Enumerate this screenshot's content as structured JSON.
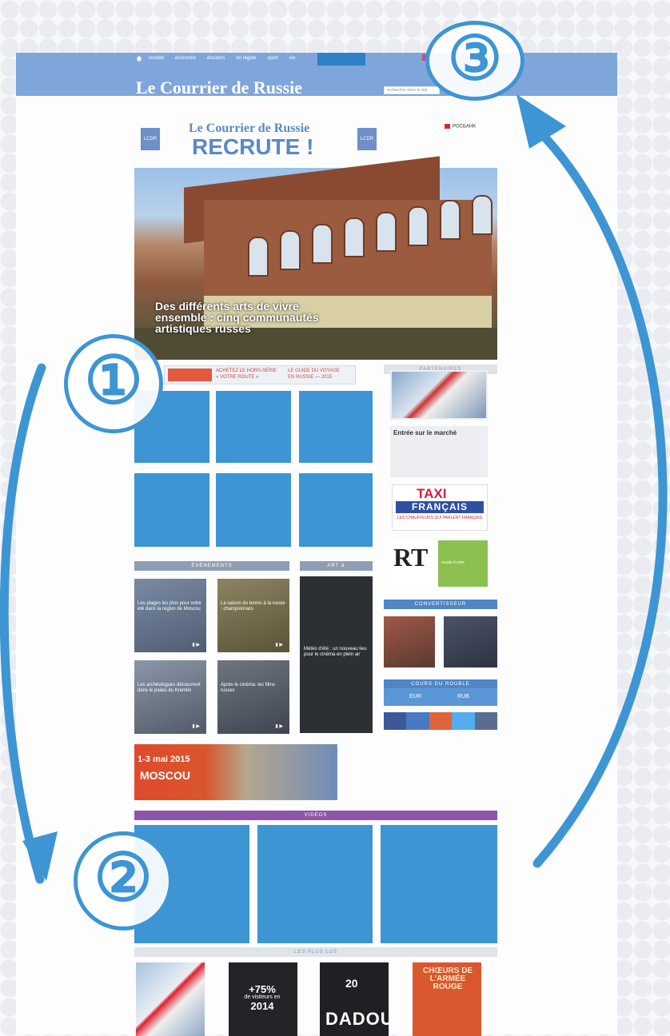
{
  "header": {
    "title": "Le Courrier de Russie",
    "nav": [
      "société",
      "économie",
      "discours",
      "en région",
      "sport",
      "vie"
    ],
    "search_placeholder": "rechercher dans le site"
  },
  "recruit": {
    "kcdr": "LCDR",
    "title_line": "Le Courrier de Russie",
    "title_big": "RECRUTE !",
    "partner": "POCБAHK"
  },
  "hero": {
    "caption": "Des différents arts de vivre ensemble : cinq communautés artistiques russes"
  },
  "adstrip": {
    "line1": "ACHETEZ LE HORS-SÉRIE",
    "line2": "« VOTRE ROUTE »",
    "line3": "LE GUIDE DU VOYAGE",
    "line4": "EN RUSSIE — 2015"
  },
  "sections": {
    "events": "ÉVÈNEMENTS",
    "arts": "ART & DIVERTISSEMENT",
    "convert": "CONVERTISSEUR",
    "currency": "COURS DU ROUBLE",
    "videos": "VIDÉOS",
    "most_read": "LES PLUS LUS",
    "sidebar_top": "PARTENAIRES"
  },
  "sidebar": {
    "marche": "Entrée sur le marché",
    "taxi": "TAXI",
    "francais": "FRANÇAIS",
    "taxi_sub": "LES CHAUFFEURS QUI PARLENT FRANÇAIS",
    "rt": "RT",
    "rt_green": "russie.rt.com"
  },
  "events": [
    {
      "caption": "Les plages les plus pour votre été dans la région de Moscou"
    },
    {
      "caption": "La saison du tennis à la russie : championnats"
    },
    {
      "caption": "Les archéologues découvrent dans le palais du Kremlin"
    },
    {
      "caption": "Après le cinéma: les films russes"
    }
  ],
  "arts": {
    "caption": "Météo d'été : un nouveau lieu pour le cinéma en plein air"
  },
  "converter": {
    "left": "EUR",
    "right": "RUB"
  },
  "moscou": {
    "date": "1-3 mai 2015",
    "city": "MOSCOU"
  },
  "bottom": {
    "pct": "+75%",
    "pct_sub1": "de visiteurs en",
    "pct_year": "2014",
    "dadu_num": "20",
    "dadu": "DADOU",
    "choeurs": "CHŒURS DE L'ARMÉE ROUGE"
  },
  "markers": {
    "one": "①",
    "two": "②",
    "three": "③"
  },
  "colors": {
    "accent": "#3d95d3",
    "header": "#7ea6db",
    "purple": "#8c56a8"
  }
}
